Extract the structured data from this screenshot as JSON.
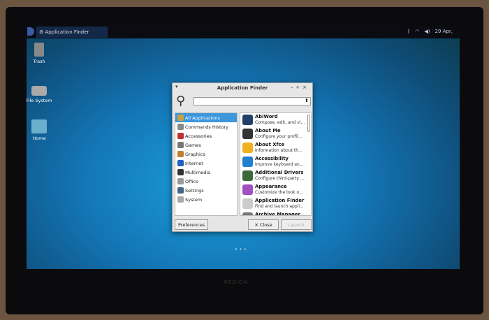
{
  "panel": {
    "task_title": "Application Finder",
    "clock": "29 Apr,"
  },
  "desktop": {
    "icons": [
      "Trash",
      "File System",
      "Home"
    ]
  },
  "window": {
    "title": "Application Finder",
    "search_value": "",
    "categories": [
      "All Applications",
      "Commands History",
      "Accessories",
      "Games",
      "Graphics",
      "Internet",
      "Multimedia",
      "Office",
      "Settings",
      "System"
    ],
    "category_colors": [
      "#c8a040",
      "#888888",
      "#c03030",
      "#777777",
      "#c08030",
      "#2060c0",
      "#333333",
      "#999999",
      "#446688",
      "#aaaaaa"
    ],
    "apps": [
      {
        "name": "AbiWord",
        "desc": "Compose, edit, and vi...",
        "color": "#24406a"
      },
      {
        "name": "About Me",
        "desc": "Configure your profil...",
        "color": "#333333"
      },
      {
        "name": "About Xfce",
        "desc": "Information about th...",
        "color": "#f0b020"
      },
      {
        "name": "Accessibility",
        "desc": "Improve keyboard an...",
        "color": "#2080d0"
      },
      {
        "name": "Additional Drivers",
        "desc": "Configure third-party ...",
        "color": "#3a6a3a"
      },
      {
        "name": "Appearance",
        "desc": "Customize the look o...",
        "color": "#a050c0"
      },
      {
        "name": "Application Finder",
        "desc": "Find and launch appli...",
        "color": "#cccccc"
      },
      {
        "name": "Archive Manager",
        "desc": "",
        "color": "#777777"
      }
    ],
    "preferences_label": "Preferences",
    "close_label": "Close",
    "launch_label": "Launch"
  },
  "bezel": {
    "brand": "MEDION"
  }
}
